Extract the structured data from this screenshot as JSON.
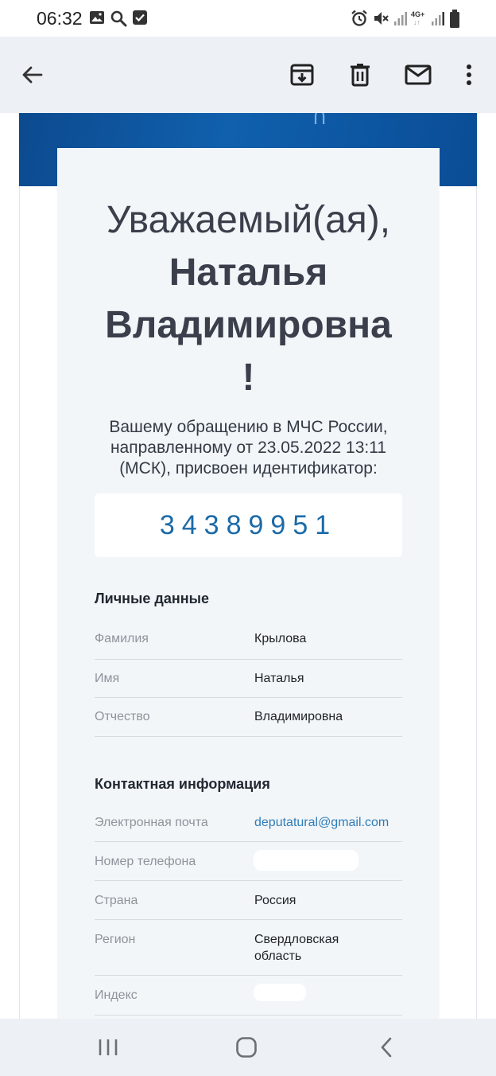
{
  "status_bar": {
    "time": "06:32",
    "network_label": "4G+",
    "left_icons": [
      "gallery-icon",
      "search-icon",
      "checkbox-icon"
    ],
    "right_icons": [
      "alarm-icon",
      "mute-icon",
      "signal-icon",
      "network-4g-icon",
      "signal-icon",
      "battery-icon"
    ]
  },
  "app_bar": {
    "icons": [
      "back-arrow-icon",
      "archive-icon",
      "delete-icon",
      "mail-icon",
      "more-vert-icon"
    ]
  },
  "email": {
    "greeting_line1": "Уважаемый(ая),",
    "greeting_name1": "Наталья",
    "greeting_name2": "Владимировна",
    "greeting_exclaim": "!",
    "intro_line1": "Вашему обращению в МЧС России,",
    "intro_line2": "направленному от 23.05.2022 13:11",
    "intro_line3": "(МСК), присвоен идентификатор:",
    "identifier": "34389951",
    "personal": {
      "title": "Личные данные",
      "rows": [
        {
          "label": "Фамилия",
          "value": "Крылова"
        },
        {
          "label": "Имя",
          "value": "Наталья"
        },
        {
          "label": "Отчество",
          "value": "Владимировна"
        }
      ]
    },
    "contact": {
      "title": "Контактная информация",
      "rows": [
        {
          "label": "Электронная почта",
          "value": "deputatural@gmail.com"
        },
        {
          "label": "Номер телефона",
          "value": ""
        },
        {
          "label": "Страна",
          "value": "Россия"
        },
        {
          "label": "Регион",
          "value_line1": "Свердловская",
          "value_line2": "область"
        },
        {
          "label": "Индекс",
          "value": ""
        }
      ]
    }
  },
  "nav_bar": {
    "icons": [
      "recent-apps-icon",
      "home-icon",
      "back-icon"
    ]
  },
  "colors": {
    "banner_blue": "#0d57a3",
    "identifier_blue": "#1a6aa8",
    "link_blue": "#2f7db8",
    "card_background": "#f3f6f9"
  }
}
